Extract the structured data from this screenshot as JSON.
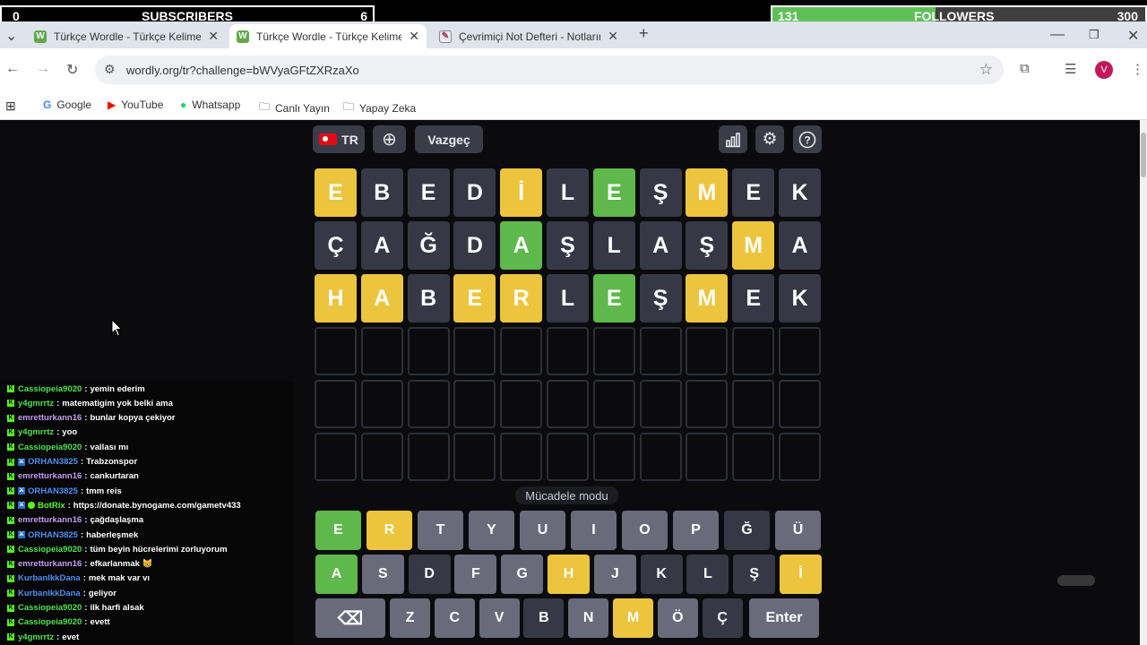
{
  "overlay": {
    "subscribers": {
      "left_value": "0",
      "label": "SUBSCRIBERS",
      "right_value": "6",
      "progress": 0
    },
    "followers": {
      "left_value": "131",
      "label": "FOLLOWERS",
      "right_value": "300",
      "progress": 0.437
    }
  },
  "browser": {
    "tabs": [
      {
        "title": "Türkçe Wordle - Türkçe Kelimel",
        "favicon": "W",
        "active": false
      },
      {
        "title": "Türkçe Wordle - Türkçe Kelimel",
        "favicon": "W",
        "active": true
      },
      {
        "title": "Çevrimiçi Not Defteri - Notların",
        "favicon": "notepad-icon",
        "active": false
      }
    ],
    "new_tab": "+",
    "url": "wordly.org/tr?challenge=bWVyaGFtZXRzaXo",
    "avatar_letter": "V",
    "bookmarks": [
      "Google",
      "YouTube",
      "Whatsapp",
      "Canlı Yayın",
      "Yapay Zeka"
    ]
  },
  "game": {
    "lang": "TR",
    "giveup": "Vazgeç",
    "mode": "Mücadele modu",
    "rows": [
      {
        "letters": [
          "E",
          "B",
          "E",
          "D",
          "İ",
          "L",
          "E",
          "Ş",
          "M",
          "E",
          "K"
        ],
        "states": [
          "y",
          "d",
          "d",
          "d",
          "y",
          "d",
          "g",
          "d",
          "y",
          "d",
          "d"
        ]
      },
      {
        "letters": [
          "Ç",
          "A",
          "Ğ",
          "D",
          "A",
          "Ş",
          "L",
          "A",
          "Ş",
          "M",
          "A"
        ],
        "states": [
          "d",
          "d",
          "d",
          "d",
          "g",
          "d",
          "d",
          "d",
          "d",
          "y",
          "d"
        ]
      },
      {
        "letters": [
          "H",
          "A",
          "B",
          "E",
          "R",
          "L",
          "E",
          "Ş",
          "M",
          "E",
          "K"
        ],
        "states": [
          "y",
          "y",
          "d",
          "y",
          "y",
          "d",
          "g",
          "d",
          "y",
          "d",
          "d"
        ]
      }
    ],
    "empty_rows": 3,
    "keyboard": [
      [
        {
          "k": "E",
          "s": "g"
        },
        {
          "k": "R",
          "s": "y"
        },
        {
          "k": "T",
          "s": "n"
        },
        {
          "k": "Y",
          "s": "n"
        },
        {
          "k": "U",
          "s": "n"
        },
        {
          "k": "I",
          "s": "n"
        },
        {
          "k": "O",
          "s": "n"
        },
        {
          "k": "P",
          "s": "n"
        },
        {
          "k": "Ğ",
          "s": "d"
        },
        {
          "k": "Ü",
          "s": "n"
        }
      ],
      [
        {
          "k": "A",
          "s": "g"
        },
        {
          "k": "S",
          "s": "n"
        },
        {
          "k": "D",
          "s": "d"
        },
        {
          "k": "F",
          "s": "n"
        },
        {
          "k": "G",
          "s": "n"
        },
        {
          "k": "H",
          "s": "y"
        },
        {
          "k": "J",
          "s": "n"
        },
        {
          "k": "K",
          "s": "d"
        },
        {
          "k": "L",
          "s": "d"
        },
        {
          "k": "Ş",
          "s": "d"
        },
        {
          "k": "İ",
          "s": "y"
        }
      ],
      [
        {
          "k": "⌫",
          "s": "n"
        },
        {
          "k": "Z",
          "s": "n"
        },
        {
          "k": "C",
          "s": "n"
        },
        {
          "k": "V",
          "s": "n"
        },
        {
          "k": "B",
          "s": "d"
        },
        {
          "k": "N",
          "s": "n"
        },
        {
          "k": "M",
          "s": "y"
        },
        {
          "k": "Ö",
          "s": "n"
        },
        {
          "k": "Ç",
          "s": "d"
        },
        {
          "k": "Enter",
          "s": "n"
        }
      ]
    ]
  },
  "chat": [
    {
      "user": "Cassiopeia9020",
      "color": "#4fe34f",
      "badges": [
        "kick"
      ],
      "text": "yemin ederim"
    },
    {
      "user": "y4gmrrtz",
      "color": "#4fe34f",
      "badges": [
        "kick"
      ],
      "text": "matematigim yok belki ama"
    },
    {
      "user": "emretturkann16",
      "color": "#c59bf2",
      "badges": [
        "kick"
      ],
      "text": "bunlar kopya çekiyor"
    },
    {
      "user": "y4gmrrtz",
      "color": "#4fe34f",
      "badges": [
        "kick"
      ],
      "text": "yoo"
    },
    {
      "user": "Cassiopeia9020",
      "color": "#4fe34f",
      "badges": [
        "kick"
      ],
      "text": "vallası mı"
    },
    {
      "user": "ORHAN3825",
      "color": "#4f8ff0",
      "badges": [
        "kick",
        "mod"
      ],
      "text": "Trabzonspor"
    },
    {
      "user": "emretturkann16",
      "color": "#c59bf2",
      "badges": [
        "kick"
      ],
      "text": "cankurtaran"
    },
    {
      "user": "ORHAN3825",
      "color": "#4f8ff0",
      "badges": [
        "kick",
        "mod"
      ],
      "text": "tmm reis"
    },
    {
      "user": "BotRix",
      "color": "#53fc18",
      "badges": [
        "kick",
        "mod",
        "bot"
      ],
      "text": "https://donate.bynogame.com/gametv433"
    },
    {
      "user": "emretturkann16",
      "color": "#c59bf2",
      "badges": [
        "kick"
      ],
      "text": "çağdaşlaşma"
    },
    {
      "user": "ORHAN3825",
      "color": "#4f8ff0",
      "badges": [
        "kick",
        "mod"
      ],
      "text": "haberleşmek"
    },
    {
      "user": "Cassiopeia9020",
      "color": "#4fe34f",
      "badges": [
        "kick"
      ],
      "text": "tüm beyin hücrelerimi zorluyorum"
    },
    {
      "user": "emretturkann16",
      "color": "#c59bf2",
      "badges": [
        "kick"
      ],
      "text": "efkarlanmak 😸"
    },
    {
      "user": "KurbanlkkDana",
      "color": "#4f8ff0",
      "badges": [
        "kick"
      ],
      "text": "mek mak var vı"
    },
    {
      "user": "KurbanlkkDana",
      "color": "#4f8ff0",
      "badges": [
        "kick"
      ],
      "text": "geliyor"
    },
    {
      "user": "Cassiopeia9020",
      "color": "#4fe34f",
      "badges": [
        "kick"
      ],
      "text": "ilk harfi alsak"
    },
    {
      "user": "Cassiopeia9020",
      "color": "#4fe34f",
      "badges": [
        "kick"
      ],
      "text": "evett"
    },
    {
      "user": "y4gmrrtz",
      "color": "#4fe34f",
      "badges": [
        "kick"
      ],
      "text": "evet"
    }
  ]
}
